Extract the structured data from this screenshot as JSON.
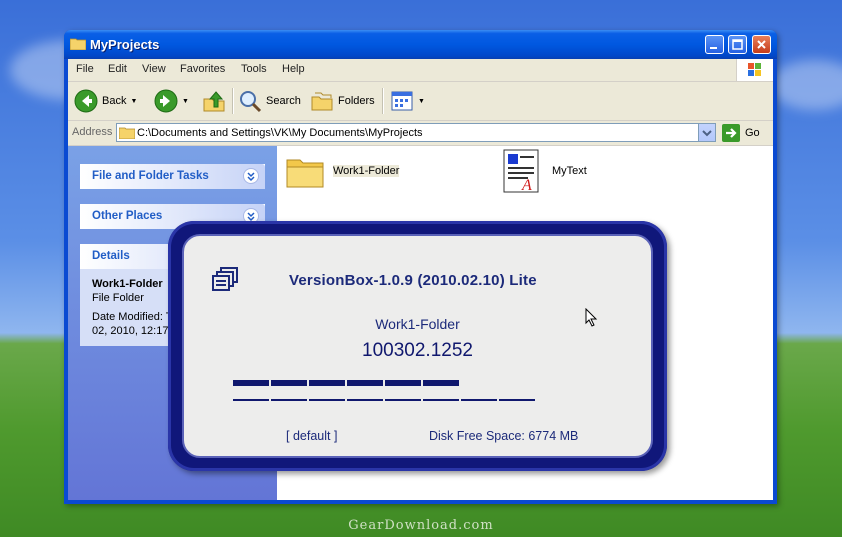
{
  "window": {
    "title": "MyProjects",
    "controls": [
      "minimize-button",
      "maximize-button",
      "close-button"
    ]
  },
  "menu": [
    "File",
    "Edit",
    "View",
    "Favorites",
    "Tools",
    "Help"
  ],
  "toolbar": {
    "back_label": "Back",
    "search_label": "Search",
    "folders_label": "Folders"
  },
  "address": {
    "label": "Address",
    "path": "C:\\Documents and Settings\\VK\\My Documents\\MyProjects",
    "go_label": "Go"
  },
  "tasks": {
    "file_folder_tasks": "File and Folder Tasks",
    "other_places": "Other Places",
    "details": "Details",
    "details_name": "Work1-Folder",
    "details_type": "File Folder",
    "details_modified_1": "Date Modified: T",
    "details_modified_2": "02, 2010, 12:17"
  },
  "files": [
    {
      "name": "Work1-Folder",
      "icon": "folder-icon"
    },
    {
      "name": "MyText",
      "icon": "text-document-icon"
    }
  ],
  "versionbox": {
    "title": "VersionBox-1.0.9 (2010.02.10)  Lite",
    "folder": "Work1-Folder",
    "version": "100302.1252",
    "default_label": "[ default ]",
    "disk_free": "Disk Free Space: 6774 MB",
    "progress_filled_segments": 6,
    "progress_total_segments": 8,
    "accent_color": "#10186e"
  },
  "watermark": "GearDownload.com"
}
